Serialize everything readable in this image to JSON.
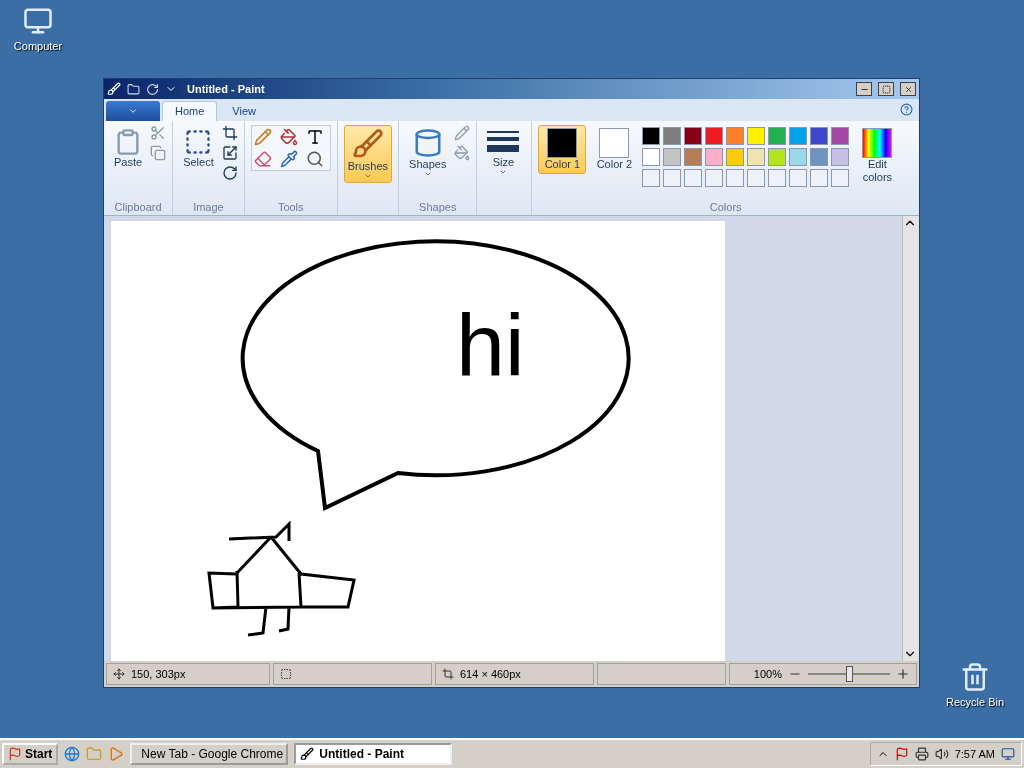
{
  "desktop_icons": [
    {
      "kind": "computer",
      "label": "Computer"
    },
    {
      "kind": "recycle-bin",
      "label": "Recycle Bin"
    }
  ],
  "window": {
    "title": "Untitled - Paint"
  },
  "tabs": [
    {
      "label": "Home",
      "selected": true
    },
    {
      "label": "View",
      "selected": false
    }
  ],
  "clipboard": {
    "paste": "Paste",
    "group_label": "Clipboard"
  },
  "image": {
    "select": "Select",
    "group_label": "Image"
  },
  "tools": {
    "group_label": "Tools"
  },
  "brushes": {
    "label": "Brushes",
    "selected": true
  },
  "shapes": {
    "label": "Shapes",
    "group_label": "Shapes"
  },
  "size": {
    "label": "Size"
  },
  "colors": {
    "group_label": "Colors",
    "edit": "Edit colors",
    "slots": [
      {
        "label": "Color 1",
        "color": "#000000",
        "selected": true
      },
      {
        "label": "Color 2",
        "color": "#ffffff",
        "selected": false
      }
    ],
    "palette": [
      {
        "color": "#000000"
      },
      {
        "color": "#7f7f7f"
      },
      {
        "color": "#880015"
      },
      {
        "color": "#ed1c24"
      },
      {
        "color": "#ff7f27"
      },
      {
        "color": "#fff200"
      },
      {
        "color": "#22b14c"
      },
      {
        "color": "#00a2e8"
      },
      {
        "color": "#3f48cc"
      },
      {
        "color": "#a349a4"
      },
      {
        "color": "#ffffff"
      },
      {
        "color": "#c3c3c3"
      },
      {
        "color": "#b97a57"
      },
      {
        "color": "#ffaec9"
      },
      {
        "color": "#ffc90e"
      },
      {
        "color": "#efe4b0"
      },
      {
        "color": "#b5e61d"
      },
      {
        "color": "#99d9ea"
      },
      {
        "color": "#7092be"
      },
      {
        "color": "#c8bfe7"
      }
    ]
  },
  "canvas": {
    "text": "hi"
  },
  "status_bar": {
    "cursor": "150, 303px",
    "dimensions": "614 × 460px",
    "zoom": "100%",
    "zoom_slider": {
      "level": 0.5
    }
  },
  "taskbar": {
    "start": "Start",
    "clock": "7:57 AM",
    "tasks": [
      {
        "kind": "browser",
        "label": "New Tab - Google Chrome",
        "selected": false
      },
      {
        "kind": "paint",
        "label": "Untitled - Paint",
        "selected": true
      }
    ]
  }
}
